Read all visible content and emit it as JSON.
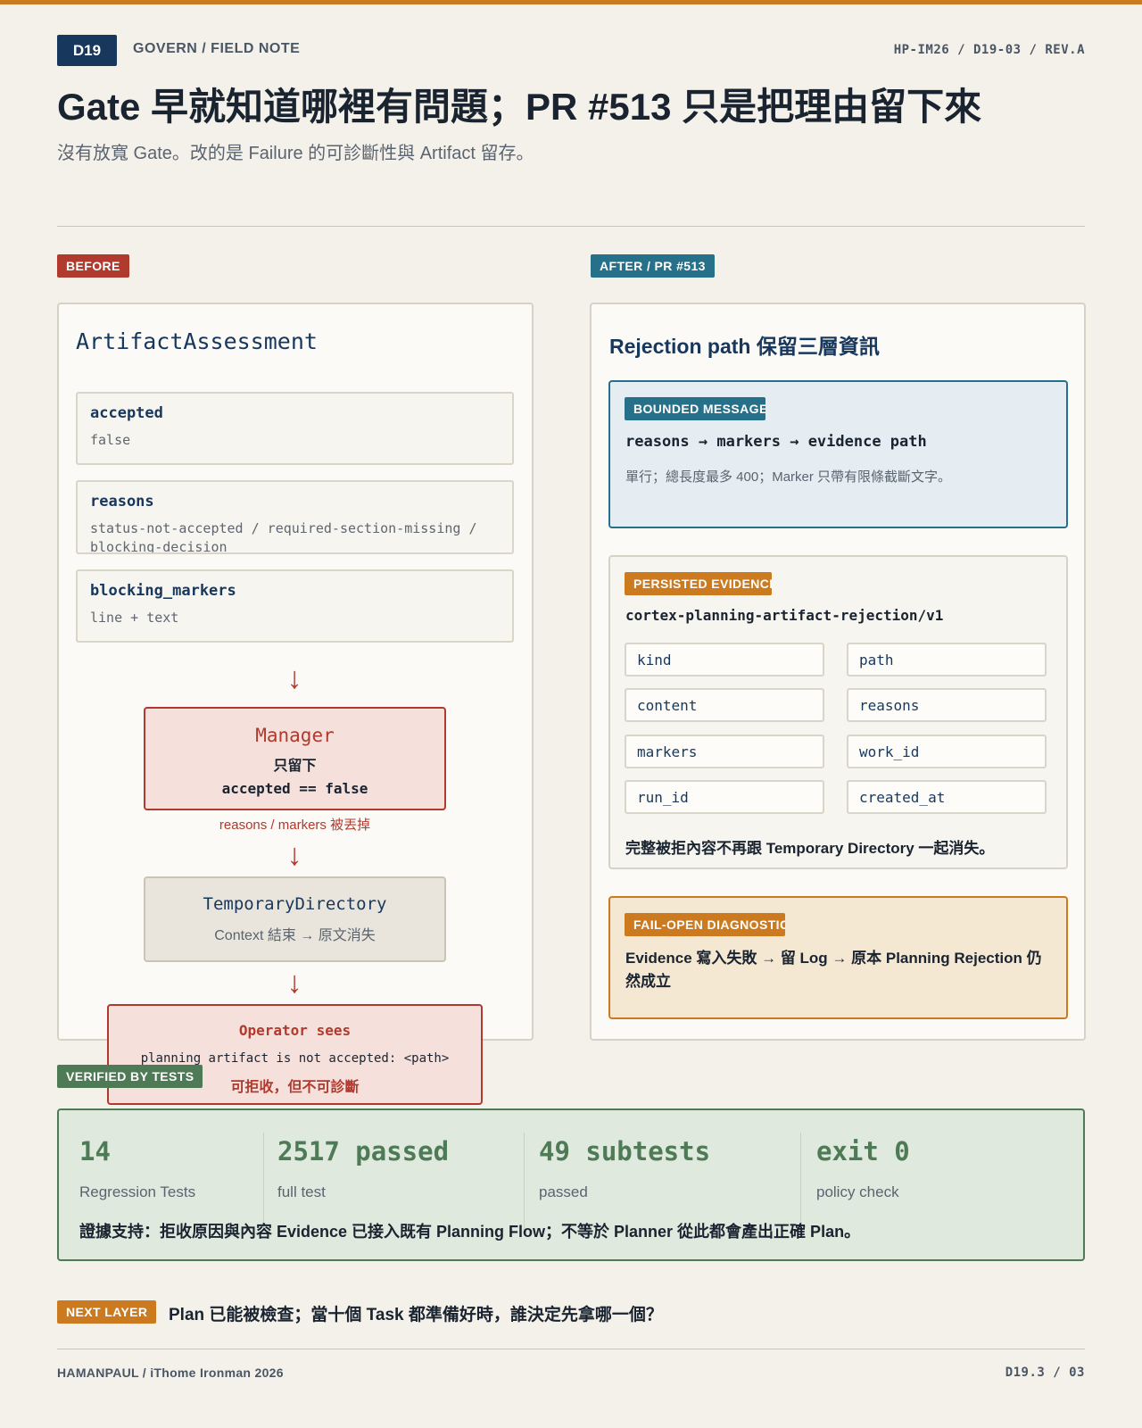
{
  "header": {
    "tag": "D19",
    "section": "GOVERN / FIELD NOTE",
    "docref": "HP-IM26 / D19-03 / REV.A",
    "title": "Gate 早就知道哪裡有問題；PR #513 只是把理由留下來",
    "subtitle": "沒有放寬 Gate。改的是 Failure 的可診斷性與 Artifact 留存。"
  },
  "before": {
    "badge": "BEFORE",
    "panel_title": "ArtifactAssessment",
    "fields": [
      {
        "name": "accepted",
        "value": "false"
      },
      {
        "name": "reasons",
        "value": "status-not-accepted / required-section-missing / blocking-decision"
      },
      {
        "name": "blocking_markers",
        "value": "line + text"
      }
    ],
    "manager": {
      "title": "Manager",
      "line1": "只留下",
      "line2": "accepted == false"
    },
    "dropped_note": "reasons / markers 被丟掉",
    "tmpdir": {
      "title": "TemporaryDirectory",
      "desc": "Context 結束 → 原文消失"
    },
    "operator": {
      "title": "Operator sees",
      "message": "planning artifact is not accepted: <path>",
      "verdict": "可拒收，但不可診斷"
    }
  },
  "after": {
    "badge": "AFTER / PR #513",
    "panel_title": "Rejection path 保留三層資訊",
    "bounded": {
      "badge": "BOUNDED MESSAGE",
      "flow": "reasons → markers → evidence path",
      "desc": "單行；總長度最多 400；Marker 只帶有限條截斷文字。"
    },
    "persisted": {
      "badge": "PERSISTED EVIDENCE",
      "schema": "cortex-planning-artifact-rejection/v1",
      "fields": [
        "kind",
        "path",
        "content",
        "reasons",
        "markers",
        "work_id",
        "run_id",
        "created_at"
      ],
      "note": "完整被拒內容不再跟 Temporary Directory 一起消失。"
    },
    "failopen": {
      "badge": "FAIL-OPEN DIAGNOSTICS",
      "text": "Evidence 寫入失敗 → 留 Log → 原本 Planning Rejection 仍然成立"
    }
  },
  "tests": {
    "badge": "VERIFIED BY TESTS",
    "stats": [
      {
        "value": "14",
        "label": "Regression Tests"
      },
      {
        "value": "2517 passed",
        "label": "full test"
      },
      {
        "value": "49 subtests",
        "label": "passed"
      },
      {
        "value": "exit 0",
        "label": "policy check"
      }
    ],
    "summary": "證據支持：拒收原因與內容 Evidence 已接入既有 Planning Flow；不等於 Planner 從此都會產出正確 Plan。"
  },
  "next": {
    "badge": "NEXT LAYER",
    "text": "Plan 已能被檢查；當十個 Task 都準備好時，誰決定先拿哪一個？"
  },
  "footer": {
    "left": "HAMANPAUL / iThome Ironman 2026",
    "right": "D19.3 / 03"
  },
  "colors": {
    "accent_orange": "#cc7a1f",
    "navy": "#17385c",
    "red": "#b03a2e",
    "teal": "#27708a",
    "green": "#4e7a55"
  }
}
